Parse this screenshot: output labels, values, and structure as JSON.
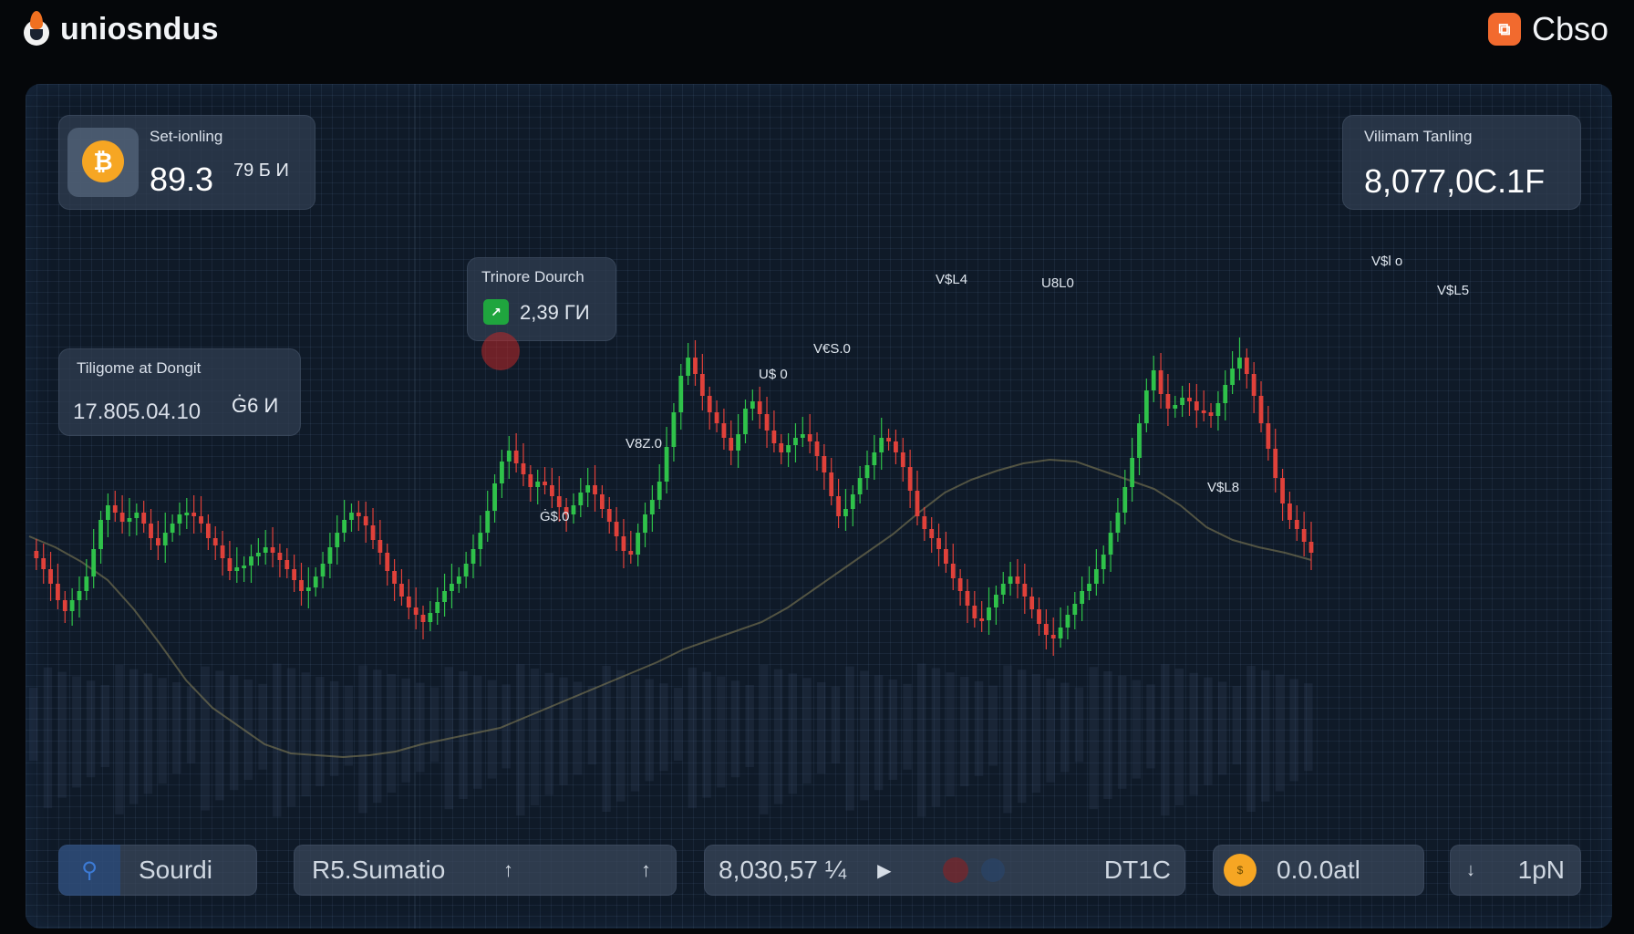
{
  "header": {
    "brand": "uniosndus",
    "account": "Cbso"
  },
  "cards": {
    "top_left": {
      "label": "Set-ionling",
      "value": "89.3",
      "sub": "79 Б И"
    },
    "top_right": {
      "label": "Vilimam Tanling",
      "value": "8,077,0C.1F"
    },
    "mid": {
      "label": "Trinore Dourch",
      "value": "2,39 ГИ"
    },
    "left": {
      "label": "Tiligome at Dongit",
      "value": "17.805.04.10",
      "sub": "Ġ6 И"
    }
  },
  "annotations": [
    "V$L4",
    "U8L0",
    "V€S.0",
    "U$ 0",
    "V8Z.0",
    "Ġ$.0",
    "V$L8",
    "V$l o",
    "V$L5"
  ],
  "bottom_bar": {
    "search_label": "Sourdi",
    "summary_label": "R5.Sumatio",
    "price": "8,030,57 ¼",
    "ticker": "DT1C",
    "balance": "0.0.0atl",
    "extra": "1pN"
  },
  "colors": {
    "up": "#2fc24a",
    "down": "#e0413a",
    "ma": "#8a8458",
    "accent": "#f6a623"
  },
  "chart_data": {
    "type": "candlestick",
    "series": [
      {
        "values": [
          512,
          520,
          532,
          548,
          566,
          578,
          566,
          556,
          540,
          510,
          478,
          462,
          470,
          480,
          476,
          470,
          482,
          498,
          506,
          492,
          482,
          472,
          470,
          474,
          482,
          498,
          506,
          520,
          534,
          530,
          528,
          518,
          514,
          508,
          514,
          522,
          532,
          544,
          556,
          552,
          540,
          526,
          508,
          492,
          478,
          470,
          474,
          484,
          500,
          514,
          534,
          548,
          562,
          574,
          582,
          590,
          580,
          568,
          556,
          548,
          540,
          526,
          510,
          492,
          468,
          438,
          414,
          402,
          416,
          428,
          442,
          436,
          440,
          452,
          464,
          472,
          462,
          448,
          440,
          450,
          466,
          480,
          496,
          512,
          516,
          492,
          472,
          456,
          436,
          398,
          360,
          320,
          300,
          318,
          342,
          360,
          372,
          388,
          402,
          384,
          356,
          348,
          362,
          380,
          394,
          404,
          396,
          388,
          384,
          392,
          408,
          426,
          452,
          474,
          466,
          450,
          432,
          418,
          404,
          388,
          392,
          404,
          420,
          446,
          474,
          488,
          498,
          510,
          526,
          542,
          556,
          572,
          586,
          588,
          574,
          560,
          548,
          540,
          548,
          562,
          576,
          592,
          604,
          608,
          596,
          582,
          570,
          556,
          548,
          532,
          516,
          492,
          470,
          442,
          410,
          372,
          336,
          314,
          340,
          356,
          352,
          344,
          348,
          358,
          360,
          364,
          350,
          330,
          312,
          300,
          318,
          342,
          372,
          400,
          432,
          460,
          478,
          488,
          502,
          514
        ]
      }
    ],
    "ma_slow": [
      502,
      514,
      530,
      550,
      582,
      620,
      660,
      690,
      710,
      730,
      740,
      742,
      744,
      742,
      738,
      730,
      724,
      718,
      712,
      700,
      688,
      676,
      664,
      652,
      640,
      626,
      616,
      606,
      596,
      580,
      560,
      540,
      520,
      500,
      476,
      454,
      440,
      430,
      422,
      418,
      420,
      430,
      440,
      450,
      468,
      492,
      506,
      514,
      520,
      528
    ]
  }
}
